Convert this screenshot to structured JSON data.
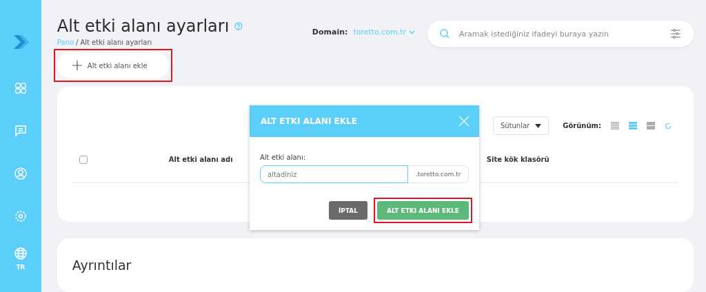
{
  "sidebar": {
    "items": [
      {
        "kind": "apps"
      },
      {
        "kind": "messages"
      },
      {
        "kind": "user"
      },
      {
        "kind": "settings"
      },
      {
        "kind": "language",
        "label": "TR"
      }
    ]
  },
  "header": {
    "title": "Alt etki alanı ayarları",
    "breadcrumb": [
      {
        "kind": "link",
        "label": "Pano"
      },
      {
        "kind": "separator",
        "label": "/"
      },
      {
        "kind": "current",
        "label": "Alt etki alanı ayarları"
      }
    ],
    "domain_label": "Domain:",
    "domain_value": "toretto.com.tr",
    "search": {
      "placeholder": "Aramak istediğiniz ifadeyi buraya yazın"
    }
  },
  "add_button": {
    "label": "Alt etki alanı ekle",
    "highlighted": true
  },
  "table": {
    "columns_button": "Sütunlar",
    "view_label": "Görünüm:",
    "views": [
      {
        "kind": "list",
        "selected": false
      },
      {
        "kind": "compact",
        "selected": true
      },
      {
        "kind": "wide",
        "selected": false
      }
    ],
    "select_all": {
      "checked": false
    },
    "columns": [
      "Alt etki alanı adı",
      "Site kök klasörü"
    ]
  },
  "details": {
    "title": "Ayrıntılar"
  },
  "dialog": {
    "title": "ALT ETKI ALANI EKLE",
    "field_label": "Alt etki alanı:",
    "value": "altadiniz",
    "suffix": ".toretto.com.tr",
    "buttons": [
      {
        "kind": "cancel",
        "label": "İPTAL",
        "highlighted": false
      },
      {
        "kind": "submit",
        "label": "ALT ETKI ALANI EKLE",
        "highlighted": true
      }
    ]
  }
}
